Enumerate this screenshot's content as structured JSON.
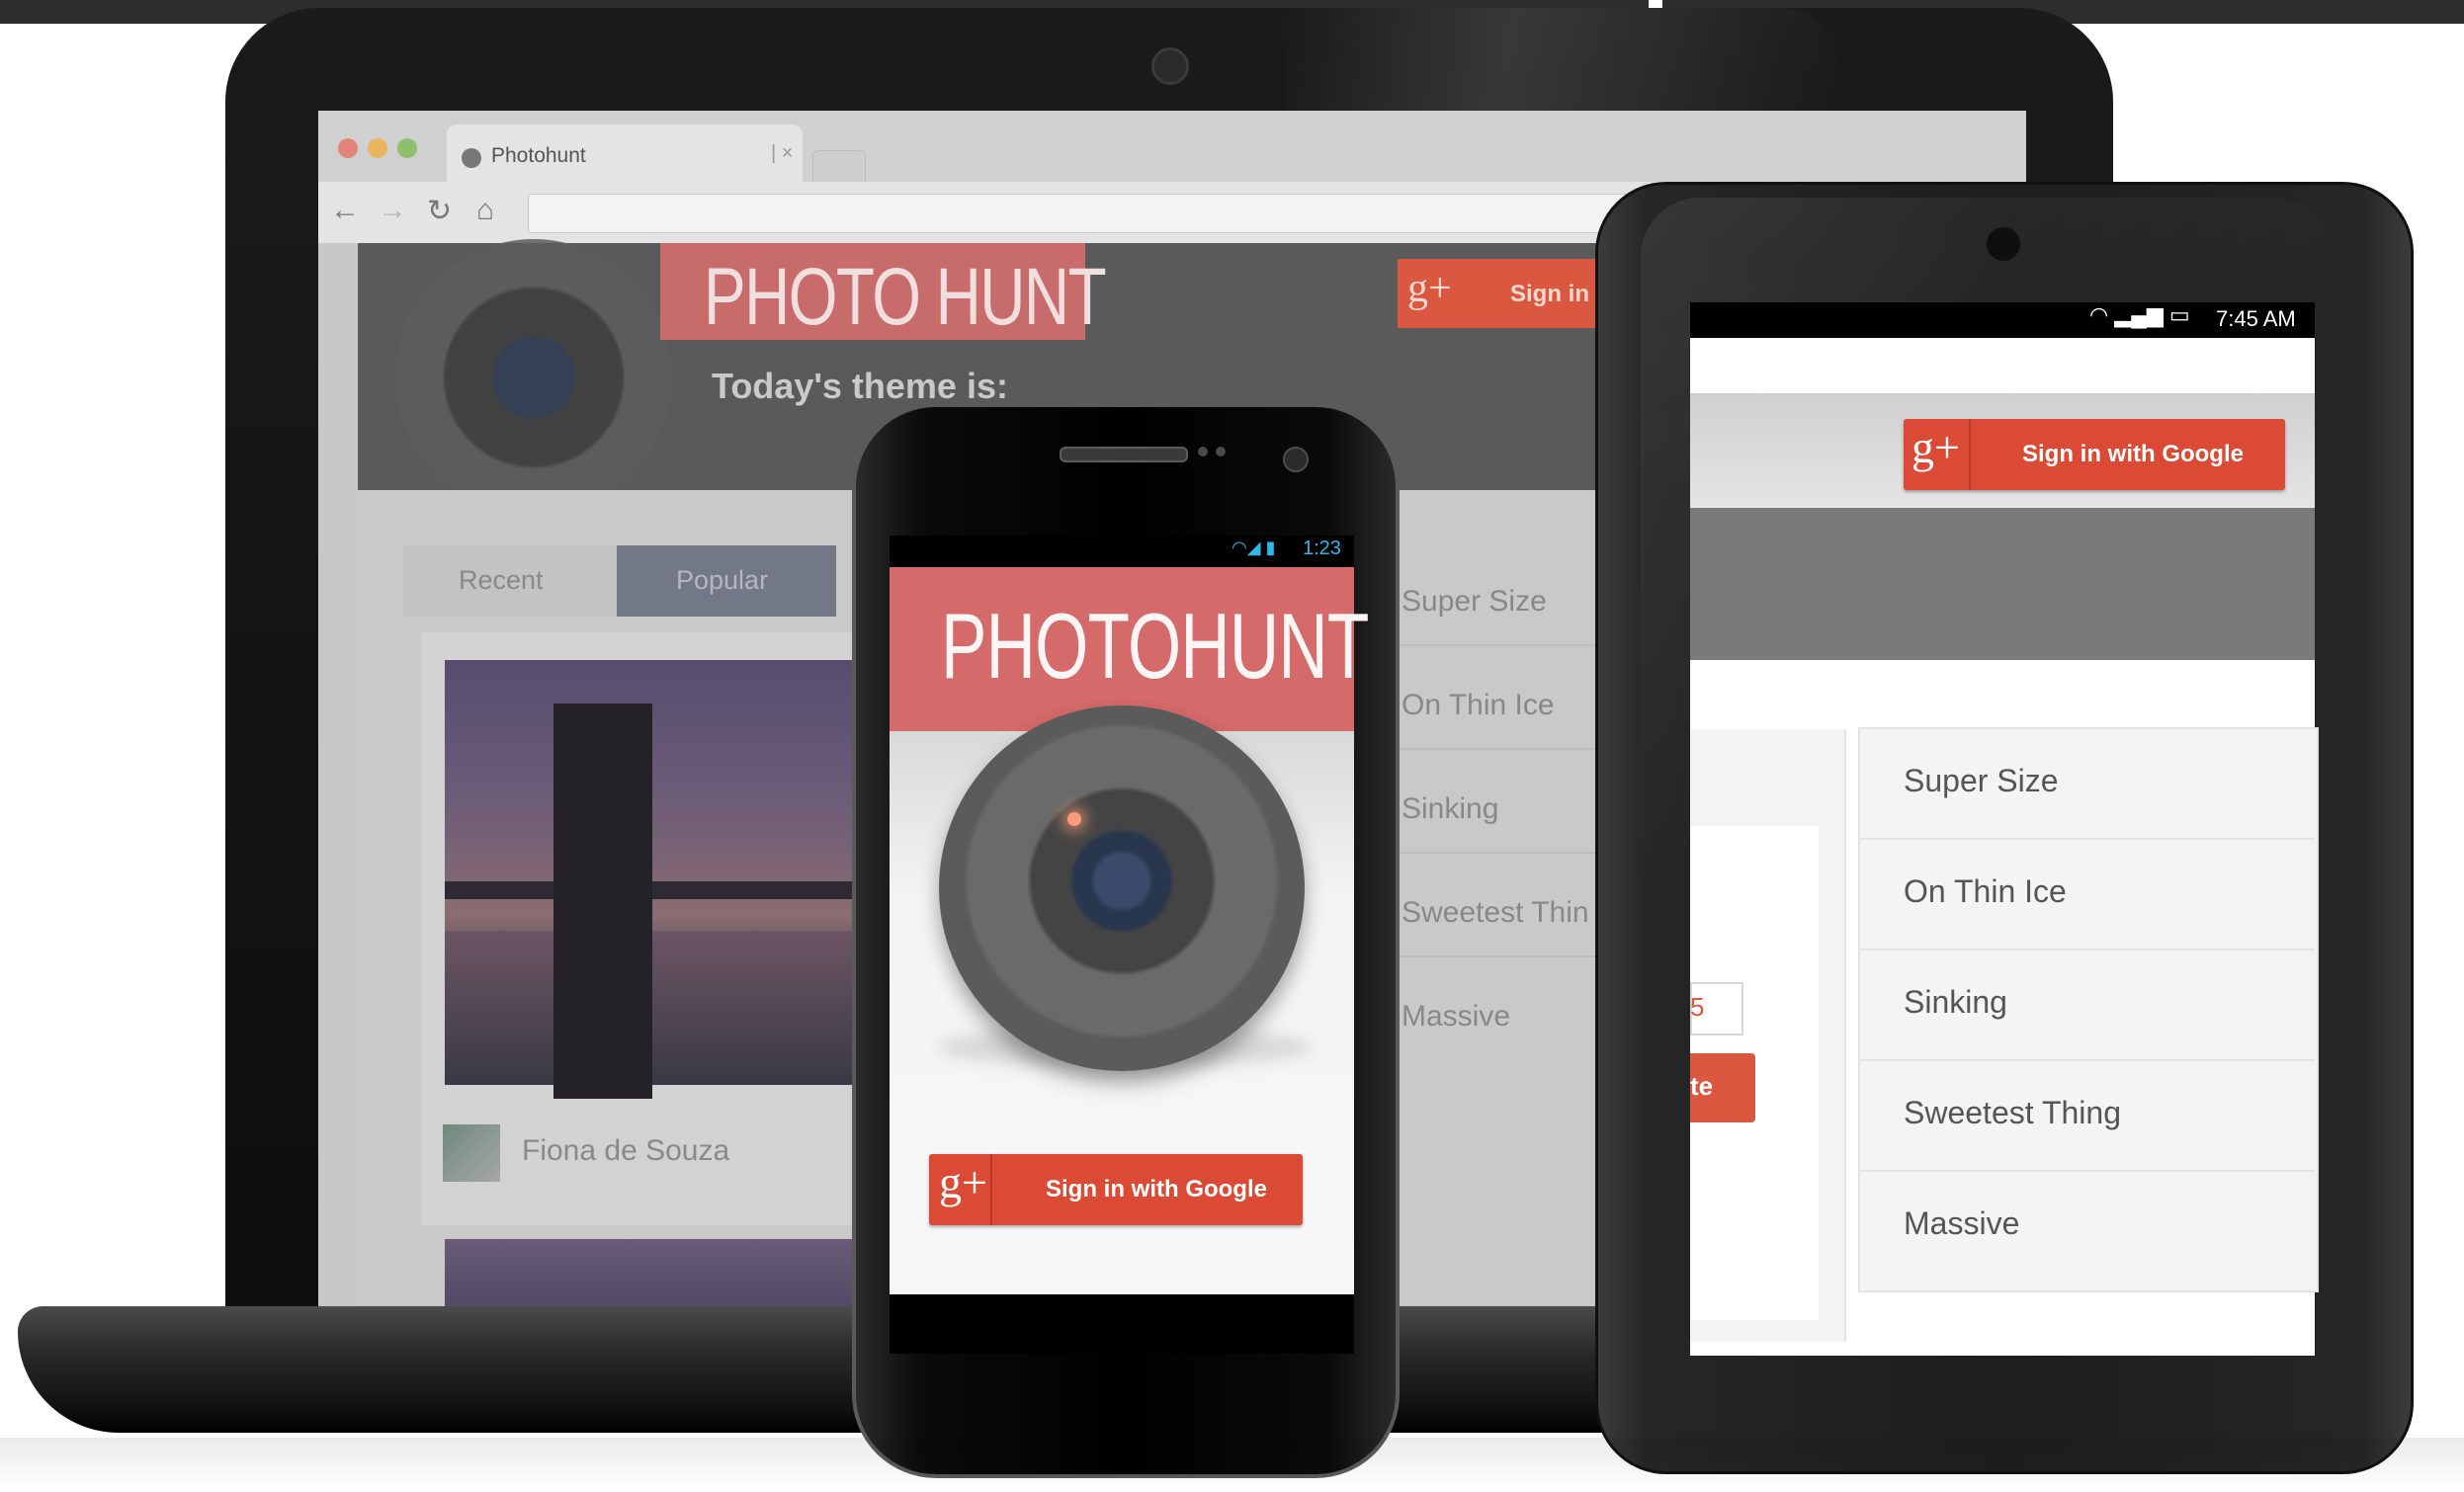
{
  "laptop": {
    "browser": {
      "tab_title": "Photohunt",
      "tab_close": "| ×"
    },
    "site": {
      "title": "PHOTO HUNT",
      "theme_label": "Today's theme is:",
      "signin_g": "g+",
      "signin_label": "Sign in",
      "tabs": [
        "Recent",
        "Popular"
      ],
      "author": "Fiona de Souza",
      "themes": [
        "Super Size",
        "On Thin Ice",
        "Sinking",
        "Sweetest Thin",
        "Massive"
      ]
    }
  },
  "phone": {
    "status_time": "1:23",
    "title": "PHOTOHUNT",
    "signin_g": "g+",
    "signin_label": "Sign in with Google"
  },
  "tablet": {
    "status_time": "7:45 AM",
    "signin_g": "g+",
    "signin_label": "Sign in with Google",
    "partial_input": "5",
    "partial_button": "te",
    "themes": [
      "Super Size",
      "On Thin Ice",
      "Sinking",
      "Sweetest Thing",
      "Massive"
    ]
  },
  "colors": {
    "google_red": "#db4a34",
    "brand_pink": "#d46a6a",
    "android_blue": "#33b5e5"
  }
}
